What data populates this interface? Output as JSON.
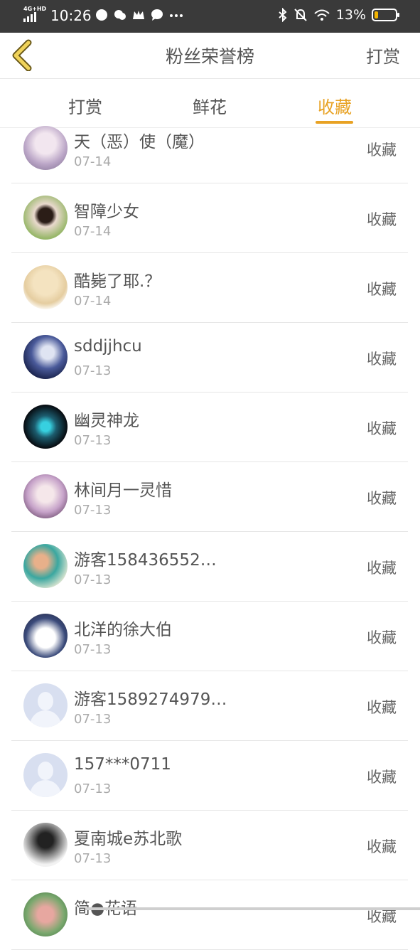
{
  "status_bar": {
    "network": "4G+HD",
    "time": "10:26",
    "battery_percent": "13%",
    "icons": [
      "signal-icon",
      "app-icon",
      "wechat-icon",
      "crown-icon",
      "chat-icon",
      "more-icon",
      "bluetooth-icon",
      "mute-icon",
      "wifi-icon",
      "battery-icon"
    ]
  },
  "header": {
    "title": "粉丝荣誉榜",
    "action": "打赏"
  },
  "tabs": [
    {
      "label": "打赏",
      "active": false
    },
    {
      "label": "鲜花",
      "active": false
    },
    {
      "label": "收藏",
      "active": true
    }
  ],
  "accent_color": "#e8a224",
  "list": [
    {
      "name": "天（恶）使（魔）",
      "date": "07-14",
      "action": "收藏"
    },
    {
      "name": "智障少女",
      "date": "07-14",
      "action": "收藏"
    },
    {
      "name": "酷毙了耶.？",
      "date": "07-14",
      "action": "收藏"
    },
    {
      "name": "sddjjhcu",
      "date": "07-13",
      "action": "收藏"
    },
    {
      "name": "幽灵神龙",
      "date": "07-13",
      "action": "收藏"
    },
    {
      "name": "林间月一灵惜",
      "date": "07-13",
      "action": "收藏"
    },
    {
      "name": "游客158436552…",
      "date": "07-13",
      "action": "收藏"
    },
    {
      "name": "北洋的徐大伯",
      "date": "07-13",
      "action": "收藏"
    },
    {
      "name": "游客1589274979…",
      "date": "07-13",
      "action": "收藏"
    },
    {
      "name": "157***0711",
      "date": "07-13",
      "action": "收藏"
    },
    {
      "name": "夏南城e苏北歌",
      "date": "07-13",
      "action": "收藏"
    },
    {
      "name": "简●花语",
      "date": "",
      "action": "收藏"
    }
  ]
}
